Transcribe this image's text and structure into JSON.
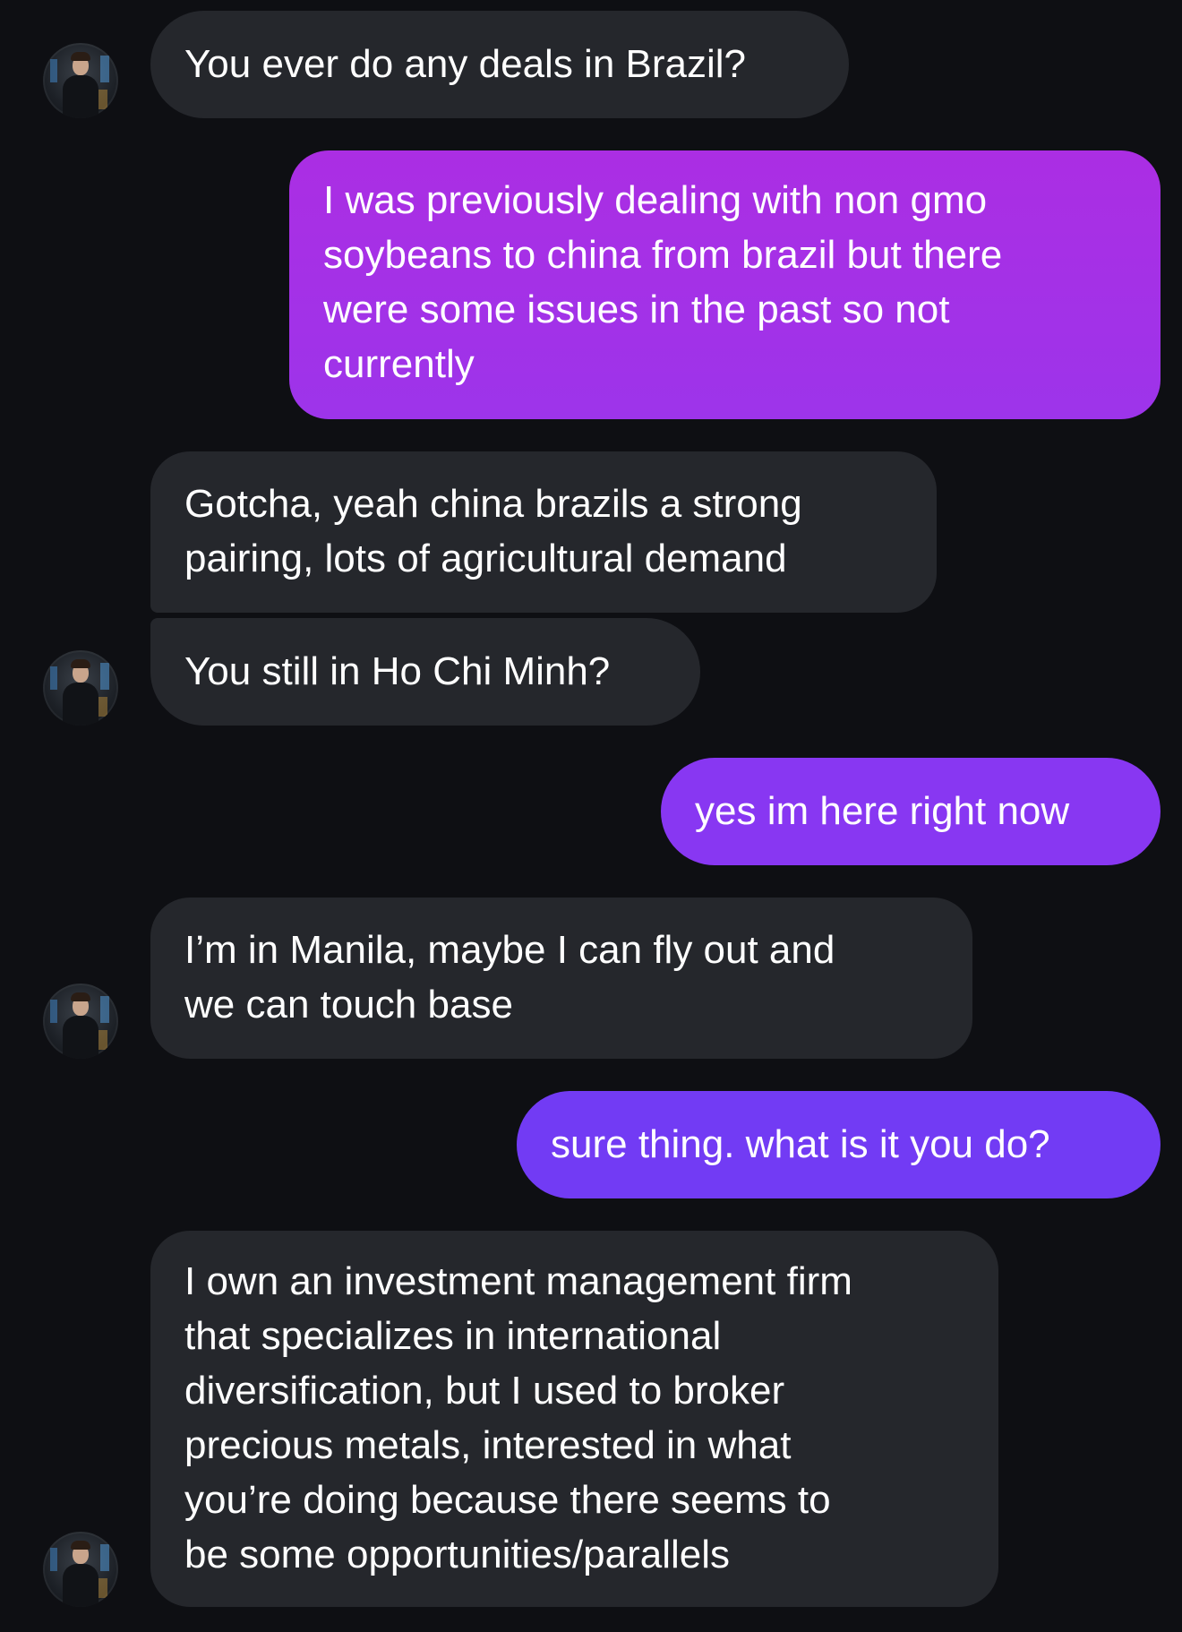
{
  "messages": [
    {
      "sender": "contact",
      "lines": [
        "You ever do any deals in Brazil?"
      ]
    },
    {
      "sender": "me",
      "lines": [
        "I was previously dealing with non gmo",
        "soybeans to china from brazil but there",
        "were some issues in the past so not",
        "currently"
      ]
    },
    {
      "sender": "contact",
      "lines": [
        "Gotcha, yeah china brazils a strong",
        "pairing, lots of agricultural demand"
      ]
    },
    {
      "sender": "contact",
      "lines": [
        "You still in Ho Chi Minh?"
      ]
    },
    {
      "sender": "me",
      "lines": [
        "yes im here right now"
      ]
    },
    {
      "sender": "contact",
      "lines": [
        "I’m in Manila, maybe I can fly out and",
        "we can touch base"
      ]
    },
    {
      "sender": "me",
      "lines": [
        "sure thing. what is it you do?"
      ]
    },
    {
      "sender": "contact",
      "lines": [
        "I own an investment management firm",
        "that specializes in international",
        "diversification, but I used to broker",
        "precious metals, interested in what",
        "you’re doing because there seems to",
        "be some opportunities/parallels"
      ]
    }
  ],
  "colors": {
    "background": "#0e0f13",
    "incoming_bubble": "#25272c",
    "outgoing_gradient_top": "#a32fe3",
    "outgoing_gradient_bottom": "#6c3bf5",
    "text": "#ffffff"
  },
  "icons": {
    "contact_avatar": "contact-avatar-icon"
  }
}
